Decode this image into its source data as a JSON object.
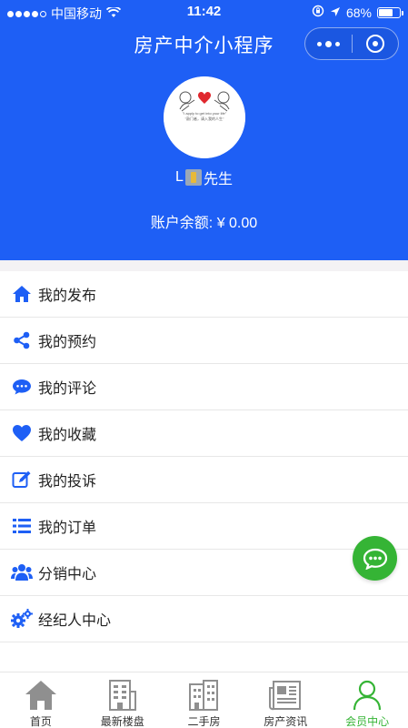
{
  "status_bar": {
    "carrier": "中国移动",
    "time": "11:42",
    "battery": "68%",
    "battery_level": 0.68
  },
  "nav": {
    "title": "房产中介小程序"
  },
  "profile": {
    "avatar_caption_en": "\"I apply to get into your life\"",
    "avatar_caption_zh": "\"敲门者，请入我的人生\"",
    "username_prefix": "L",
    "username_suffix": "先生",
    "balance": "账户余额: ¥ 0.00"
  },
  "menu": [
    {
      "label": "我的发布",
      "icon": "home-icon"
    },
    {
      "label": "我的预约",
      "icon": "share-icon"
    },
    {
      "label": "我的评论",
      "icon": "comment-icon"
    },
    {
      "label": "我的收藏",
      "icon": "heart-icon"
    },
    {
      "label": "我的投诉",
      "icon": "edit-icon"
    },
    {
      "label": "我的订单",
      "icon": "list-icon"
    },
    {
      "label": "分销中心",
      "icon": "users-icon"
    },
    {
      "label": "经纪人中心",
      "icon": "gears-icon"
    }
  ],
  "tabs": [
    {
      "label": "首页",
      "icon": "house-icon"
    },
    {
      "label": "最新楼盘",
      "icon": "building-icon"
    },
    {
      "label": "二手房",
      "icon": "apartment-icon"
    },
    {
      "label": "房产资讯",
      "icon": "newspaper-icon"
    },
    {
      "label": "会员中心",
      "icon": "user-icon",
      "active": true
    }
  ],
  "colors": {
    "header_bg": "#1e5ff5",
    "icon_blue": "#1e5ff5",
    "active_green": "#35b435"
  }
}
